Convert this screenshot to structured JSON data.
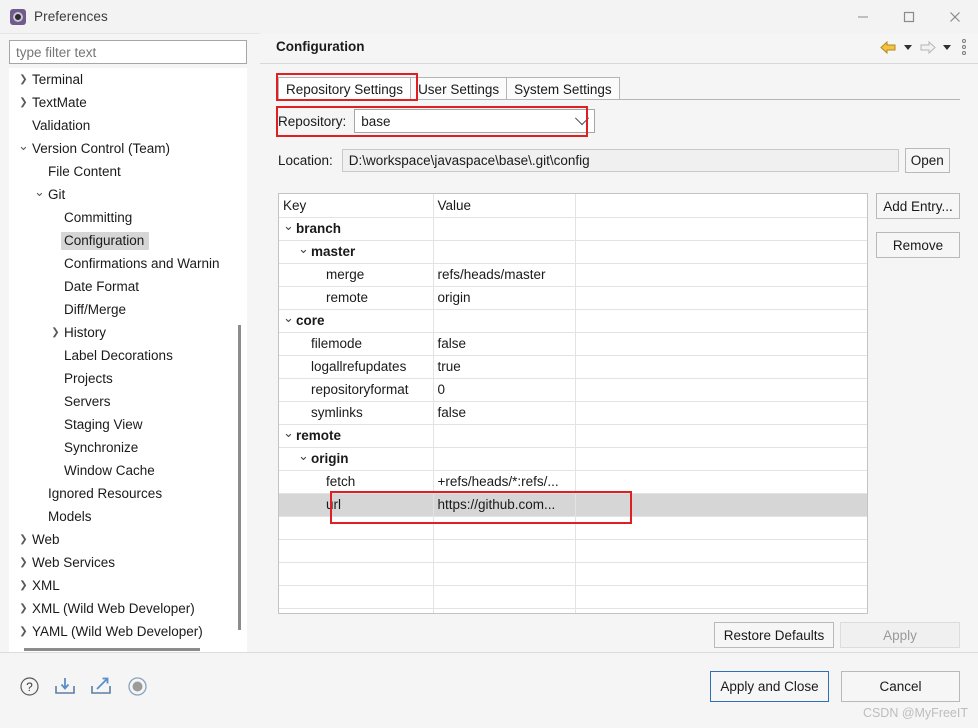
{
  "window": {
    "title": "Preferences",
    "icon": "preferences-gear-icon",
    "controls": {
      "minimize": "—",
      "maximize": "□",
      "close": "✕"
    }
  },
  "filter": {
    "placeholder": "type filter text",
    "value": ""
  },
  "tree": {
    "items": [
      {
        "label": "Terminal",
        "level": 0,
        "twisty": "collapsed",
        "selected": false
      },
      {
        "label": "TextMate",
        "level": 0,
        "twisty": "collapsed",
        "selected": false
      },
      {
        "label": "Validation",
        "level": 0,
        "twisty": "none",
        "selected": false
      },
      {
        "label": "Version Control (Team)",
        "level": 0,
        "twisty": "expanded",
        "selected": false
      },
      {
        "label": "File Content",
        "level": 1,
        "twisty": "none",
        "selected": false
      },
      {
        "label": "Git",
        "level": 1,
        "twisty": "expanded",
        "selected": false
      },
      {
        "label": "Committing",
        "level": 2,
        "twisty": "none",
        "selected": false
      },
      {
        "label": "Configuration",
        "level": 2,
        "twisty": "none",
        "selected": true
      },
      {
        "label": "Confirmations and Warnin",
        "level": 2,
        "twisty": "none",
        "selected": false
      },
      {
        "label": "Date Format",
        "level": 2,
        "twisty": "none",
        "selected": false
      },
      {
        "label": "Diff/Merge",
        "level": 2,
        "twisty": "none",
        "selected": false
      },
      {
        "label": "History",
        "level": 2,
        "twisty": "collapsed",
        "selected": false
      },
      {
        "label": "Label Decorations",
        "level": 2,
        "twisty": "none",
        "selected": false
      },
      {
        "label": "Projects",
        "level": 2,
        "twisty": "none",
        "selected": false
      },
      {
        "label": "Servers",
        "level": 2,
        "twisty": "none",
        "selected": false
      },
      {
        "label": "Staging View",
        "level": 2,
        "twisty": "none",
        "selected": false
      },
      {
        "label": "Synchronize",
        "level": 2,
        "twisty": "none",
        "selected": false
      },
      {
        "label": "Window Cache",
        "level": 2,
        "twisty": "none",
        "selected": false
      },
      {
        "label": "Ignored Resources",
        "level": 1,
        "twisty": "none",
        "selected": false
      },
      {
        "label": "Models",
        "level": 1,
        "twisty": "none",
        "selected": false
      },
      {
        "label": "Web",
        "level": 0,
        "twisty": "collapsed",
        "selected": false
      },
      {
        "label": "Web Services",
        "level": 0,
        "twisty": "collapsed",
        "selected": false
      },
      {
        "label": "XML",
        "level": 0,
        "twisty": "collapsed",
        "selected": false
      },
      {
        "label": "XML (Wild Web Developer)",
        "level": 0,
        "twisty": "collapsed",
        "selected": false
      },
      {
        "label": "YAML (Wild Web Developer)",
        "level": 0,
        "twisty": "collapsed",
        "selected": false
      }
    ]
  },
  "page": {
    "title": "Configuration",
    "header_tools": [
      "back-arrow-icon",
      "back-dropdown-caret",
      "forward-arrow-icon",
      "forward-dropdown-caret",
      "view-menu-kebab-icon"
    ],
    "tabs": [
      {
        "label": "Repository Settings",
        "active": true
      },
      {
        "label": "User Settings",
        "active": false
      },
      {
        "label": "System Settings",
        "active": false
      }
    ],
    "repository": {
      "label": "Repository:",
      "value": "base"
    },
    "location": {
      "label": "Location:",
      "value": "D:\\workspace\\javaspace\\base\\.git\\config"
    },
    "open_button": "Open",
    "side_buttons": {
      "add_entry": "Add Entry...",
      "remove": "Remove"
    },
    "restore_defaults": "Restore Defaults",
    "apply": "Apply"
  },
  "config_table": {
    "headers": [
      "Key",
      "Value",
      ""
    ],
    "rows": [
      {
        "key": "branch",
        "value": "",
        "level": 0,
        "twisty": "expanded",
        "bold": true,
        "selected": false
      },
      {
        "key": "master",
        "value": "",
        "level": 1,
        "twisty": "expanded",
        "bold": true,
        "selected": false
      },
      {
        "key": "merge",
        "value": "refs/heads/master",
        "level": 2,
        "twisty": "none",
        "bold": false,
        "selected": false
      },
      {
        "key": "remote",
        "value": "origin",
        "level": 2,
        "twisty": "none",
        "bold": false,
        "selected": false
      },
      {
        "key": "core",
        "value": "",
        "level": 0,
        "twisty": "expanded",
        "bold": true,
        "selected": false
      },
      {
        "key": "filemode",
        "value": "false",
        "level": 1,
        "twisty": "none",
        "bold": false,
        "selected": false
      },
      {
        "key": "logallrefupdates",
        "value": "true",
        "level": 1,
        "twisty": "none",
        "bold": false,
        "selected": false
      },
      {
        "key": "repositoryformat",
        "value": "0",
        "level": 1,
        "twisty": "none",
        "bold": false,
        "selected": false
      },
      {
        "key": "symlinks",
        "value": "false",
        "level": 1,
        "twisty": "none",
        "bold": false,
        "selected": false
      },
      {
        "key": "remote",
        "value": "",
        "level": 0,
        "twisty": "expanded",
        "bold": true,
        "selected": false
      },
      {
        "key": "origin",
        "value": "",
        "level": 1,
        "twisty": "expanded",
        "bold": true,
        "selected": false
      },
      {
        "key": "fetch",
        "value": "+refs/heads/*:refs/...",
        "level": 2,
        "twisty": "none",
        "bold": false,
        "selected": false
      },
      {
        "key": "url",
        "value": "https://github.com...",
        "level": 2,
        "twisty": "none",
        "bold": false,
        "selected": true
      },
      {
        "key": "",
        "value": "",
        "level": 0,
        "twisty": "none",
        "bold": false,
        "selected": false
      },
      {
        "key": "",
        "value": "",
        "level": 0,
        "twisty": "none",
        "bold": false,
        "selected": false
      },
      {
        "key": "",
        "value": "",
        "level": 0,
        "twisty": "none",
        "bold": false,
        "selected": false
      },
      {
        "key": "",
        "value": "",
        "level": 0,
        "twisty": "none",
        "bold": false,
        "selected": false
      },
      {
        "key": "",
        "value": "",
        "level": 0,
        "twisty": "none",
        "bold": false,
        "selected": false
      }
    ]
  },
  "footer": {
    "icons": [
      "help-question-icon",
      "import-preferences-icon",
      "export-preferences-icon",
      "record-circle-icon"
    ],
    "apply_and_close": "Apply and Close",
    "cancel": "Cancel"
  },
  "annotations": {
    "highlight_color": "#e02020",
    "boxes": [
      "repository-settings-tab",
      "repository-combo-row",
      "url-table-row"
    ]
  },
  "watermark": "CSDN @MyFreeIT"
}
